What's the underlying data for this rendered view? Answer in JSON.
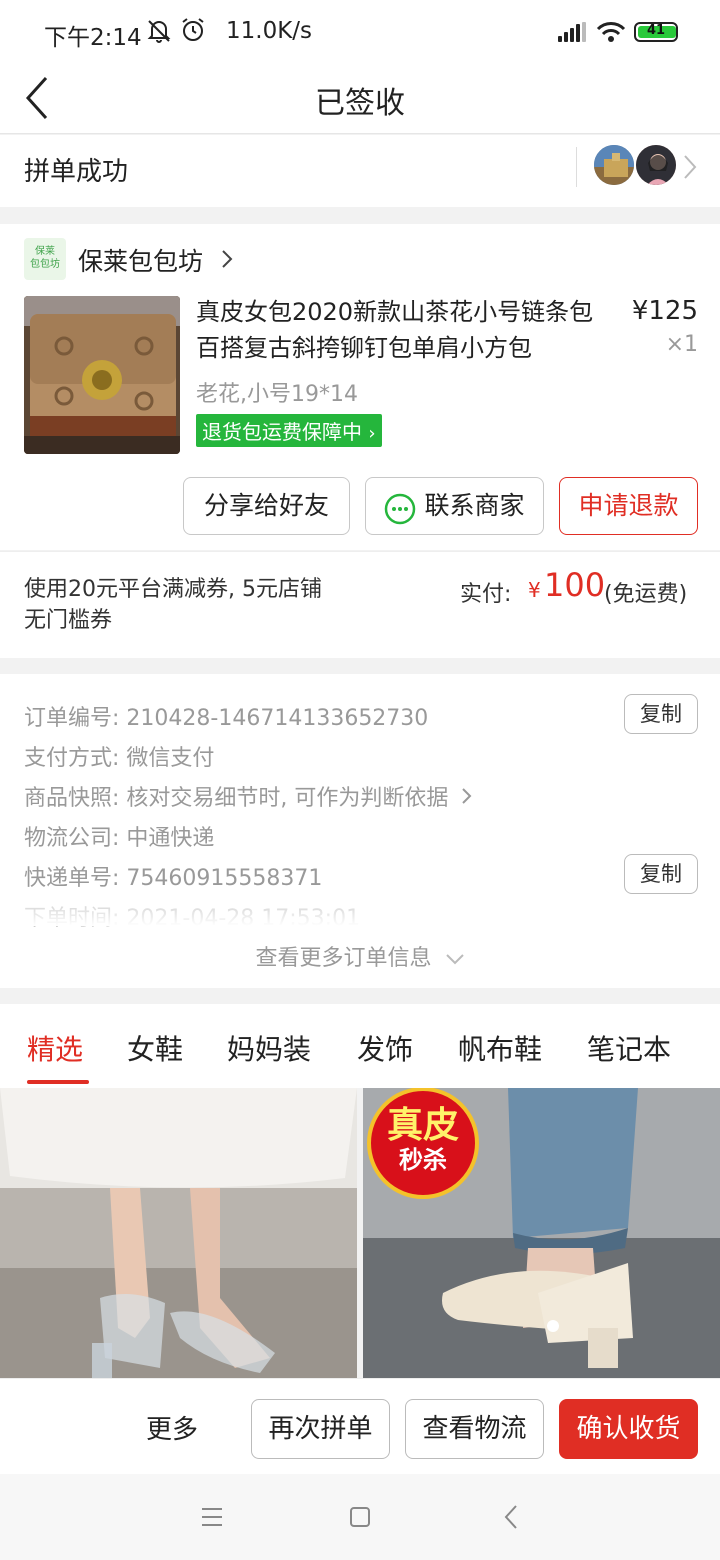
{
  "status_bar": {
    "time": "下午2:14",
    "speed": "11.0K/s",
    "battery": "41"
  },
  "header": {
    "title": "已签收"
  },
  "group": {
    "label": "拼单成功"
  },
  "shop": {
    "logo_text": "保莱包包坊",
    "name": "保莱包包坊"
  },
  "product": {
    "title": "真皮女包2020新款山茶花小号链条包百搭复古斜挎铆钉包单肩小方包",
    "price": "¥125",
    "qty": "×1",
    "spec": "老花,小号19*14",
    "badge": "退货包运费保障中"
  },
  "card_buttons": {
    "share": "分享给好友",
    "contact": "联系商家",
    "refund": "申请退款"
  },
  "payment": {
    "coupon": "使用20元平台满减券, 5元店铺无门槛券",
    "paid_label": "实付:",
    "currency": "¥",
    "amount": "100",
    "shipping": "(免运费)"
  },
  "order_info": {
    "order_no_label": "订单编号:",
    "order_no": "210428-146714133652730",
    "pay_method_label": "支付方式:",
    "pay_method": "微信支付",
    "snapshot_label": "商品快照:",
    "snapshot": "核对交易细节时, 可作为判断依据",
    "logistics_label": "物流公司:",
    "logistics": "中通快递",
    "tracking_label": "快递单号:",
    "tracking": "75460915558371",
    "time_label": "下单时间:",
    "time": "2021-04-28 17:53:01",
    "copy": "复制",
    "more": "查看更多订单信息"
  },
  "tabs": [
    "精选",
    "女鞋",
    "妈妈装",
    "发饰",
    "帆布鞋",
    "笔记本"
  ],
  "feed": {
    "promo_line1": "真皮",
    "promo_line2": "秒杀"
  },
  "actions": {
    "more": "更多",
    "regroup": "再次拼单",
    "logistics": "查看物流",
    "confirm": "确认收货"
  },
  "colors": {
    "accent": "#e02e24",
    "green": "#25b63c"
  }
}
